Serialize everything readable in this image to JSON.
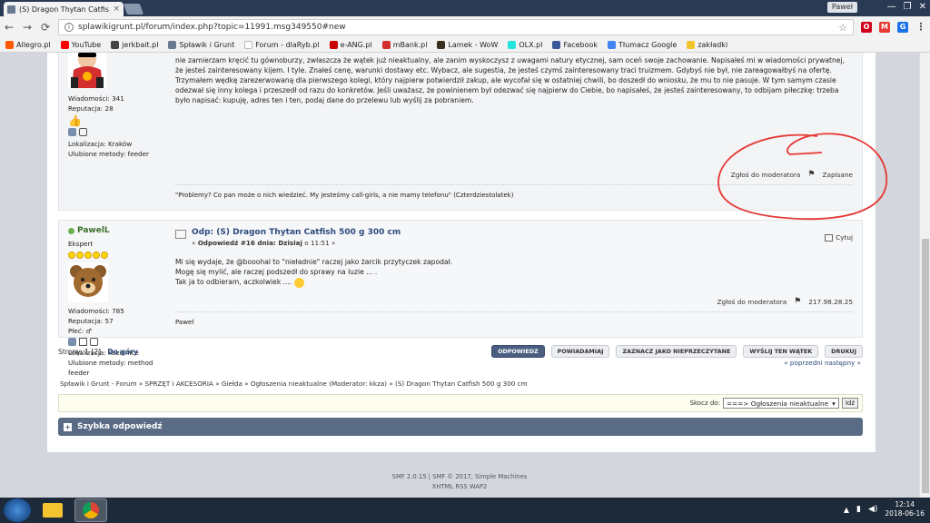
{
  "browser": {
    "tab_title": "(S) Dragon Thytan Catfish",
    "tab_close": "×",
    "profile_name": "Paweł",
    "window_controls": [
      "—",
      "❐",
      "✕"
    ],
    "url": "splawikigrunt.pl/forum/index.php?topic=11991.msg349550#new",
    "nav": {
      "back": "←",
      "forward": "→",
      "reload": "⟳"
    },
    "extensions": [
      {
        "label": "O",
        "color": "#d0021b"
      },
      {
        "label": "M",
        "color": "#e53935"
      },
      {
        "label": "G",
        "color": "#1a73e8"
      },
      {
        "label": "⋮",
        "color": "#777777"
      }
    ],
    "bookmarks": [
      {
        "label": "Allegro.pl",
        "color": "#ff5a00"
      },
      {
        "label": "YouTube",
        "color": "#ff0000"
      },
      {
        "label": "jerkbait.pl",
        "color": "#444444"
      },
      {
        "label": "Spławik i Grunt",
        "color": "#6a7a90"
      },
      {
        "label": "Forum - dlaRyb.pl",
        "color": "#ffffff"
      },
      {
        "label": "e-ANG.pl",
        "color": "#cc0000"
      },
      {
        "label": "mBank.pl",
        "color": "#d32f2f"
      },
      {
        "label": "Lamek - WoW",
        "color": "#3b2f1f"
      },
      {
        "label": "OLX.pl",
        "color": "#23e5db"
      },
      {
        "label": "Facebook",
        "color": "#3b5998"
      },
      {
        "label": "Tłumacz Google",
        "color": "#4285f4"
      },
      {
        "label": "zakładki",
        "color": "#f4c430"
      }
    ]
  },
  "post1": {
    "stats": [
      "Wiadomości: 341",
      "Reputacja: 28"
    ],
    "location": "Lokalizacja: Kraków",
    "method": "Ulubione metody: feeder",
    "body": [
      "nie zamierzam kręcić tu gównoburzy, zwłaszcza że wątek już nieaktualny, ale zanim wyskoczysz z uwagami natury etycznej, sam oceń swoje zachowanie. Napisałeś mi w wiadomości prywatnej, że jesteś zainteresowany kijem. I tyle. Znałeś cenę, warunki dostawy etc. Wybacz, ale sugestia, że jesteś czymś zainteresowany traci truizmem. Gdybyś nie był, nie zareagowałbyś na ofertę.",
      "Trzymałem wędkę zarezerwowaną dla pierwszego kolegi, który najpierw potwierdził zakup, ale wycofał się w ostatniej chwili, bo doszedł do wniosku, że mu to nie pasuje. W tym samym czasie odezwał się inny kolega i przeszedł od razu do konkretów. Jeśli uważasz, że powinienem był odezwać się najpierw do Ciebie, bo napisałeś, że jesteś zainteresowany, to odbijam piłeczkę: trzeba było napisać: kupuję, adres ten i ten, podaj dane do przelewu lub wyślij za pobraniem."
    ],
    "report": "Zgłoś do moderatora",
    "logged": "Zapisane",
    "signature": "\"Problemy? Co pan może o nich wiedzieć. My jesteśmy call-girls, a nie mamy telefonu\" (Czterdziestolatek)"
  },
  "post2": {
    "name": "PawelL",
    "rank": "Ekspert",
    "stats": [
      "Wiadomości: 785",
      "Reputacja: 57",
      "Płeć: ♂"
    ],
    "location": "Lokalizacja: Kozienice",
    "method": "Ulubione metody: method feeder",
    "subject": "Odp: (S) Dragon Thytan Catfish 500 g 300 cm",
    "reply_info_prefix": "« ",
    "reply_info_bold": "Odpowiedź #16 dnia: Dzisiaj",
    "reply_info_rest": " o 11:51 »",
    "quote": "Cytuj",
    "body": [
      "Mi się wydaje, że @booohal to \"nieładnie\" raczej jako żarcik przytyczek zapodał.",
      "Mogę się mylić, ale raczej podszedł do sprawy na luzie ... .",
      "Tak ja to odbieram, aczkolwiek ...."
    ],
    "report": "Zgłoś do moderatora",
    "ip": "217.98.28.25",
    "signature": "Paweł"
  },
  "pagination": {
    "label": "Strony: 1",
    "current": "[2]",
    "top": "Do góry",
    "prev_next": "« poprzedni następny »"
  },
  "buttons": [
    "ODPOWIEDZ",
    "POWIADAMIAJ",
    "ZAZNACZ JAKO NIEPRZECZYTANE",
    "WYŚLIJ TEN WĄTEK",
    "DRUKUJ"
  ],
  "breadcrumb": "Spławik i Grunt - Forum » SPRZĘT i AKCESORIA » Giełda » Ogłoszenia nieaktualne (Moderator: kkza) » (S) Dragon Thytan Catfish 500 g 300 cm",
  "jump": {
    "label": "Skocz do:",
    "selected": "===> Ogłoszenia nieaktualne",
    "go": "Idź"
  },
  "quick_reply": "Szybka odpowiedź",
  "footer": {
    "line1": "SMF 2.0.15 | SMF © 2017, Simple Machines",
    "line2": "XHTML   RSS   WAP2"
  },
  "taskbar": {
    "time": "12:14",
    "date": "2018-06-16"
  },
  "colors": {
    "annotation_circle": "#e53935",
    "accent_header": "#5a6b85",
    "link": "#2d4a7c",
    "online": "#6ab04c"
  }
}
